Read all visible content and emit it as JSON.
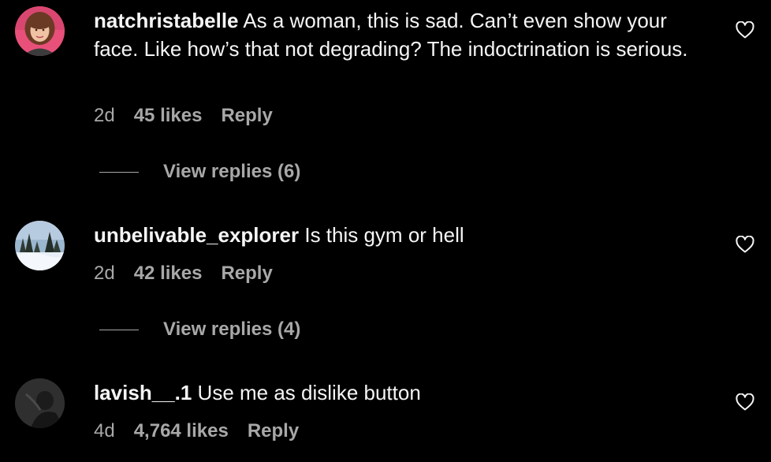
{
  "comments": [
    {
      "username": "natchristabelle",
      "text": "As a woman, this is sad. Can’t even show your face. Like how’s that not degrading? The indoctrination is serious.",
      "time": "2d",
      "likes": "45 likes",
      "reply_label": "Reply",
      "view_replies": "View replies (6)",
      "avatar": "profile-photo-woman",
      "like_icon": "heart-outline-icon"
    },
    {
      "username": "unbelivable_explorer",
      "text": "Is this gym or hell",
      "time": "2d",
      "likes": "42 likes",
      "reply_label": "Reply",
      "view_replies": "View replies (4)",
      "avatar": "profile-photo-snowy-trees",
      "like_icon": "heart-outline-icon"
    },
    {
      "username": "lavish__.1",
      "text": "Use me as dislike button",
      "time": "4d",
      "likes": "4,764 likes",
      "reply_label": "Reply",
      "avatar": "profile-photo-dark",
      "like_icon": "heart-outline-icon"
    }
  ],
  "colors": {
    "background": "#000000",
    "primary_text": "#f5f5f5",
    "secondary_text": "#a8a8a8"
  }
}
